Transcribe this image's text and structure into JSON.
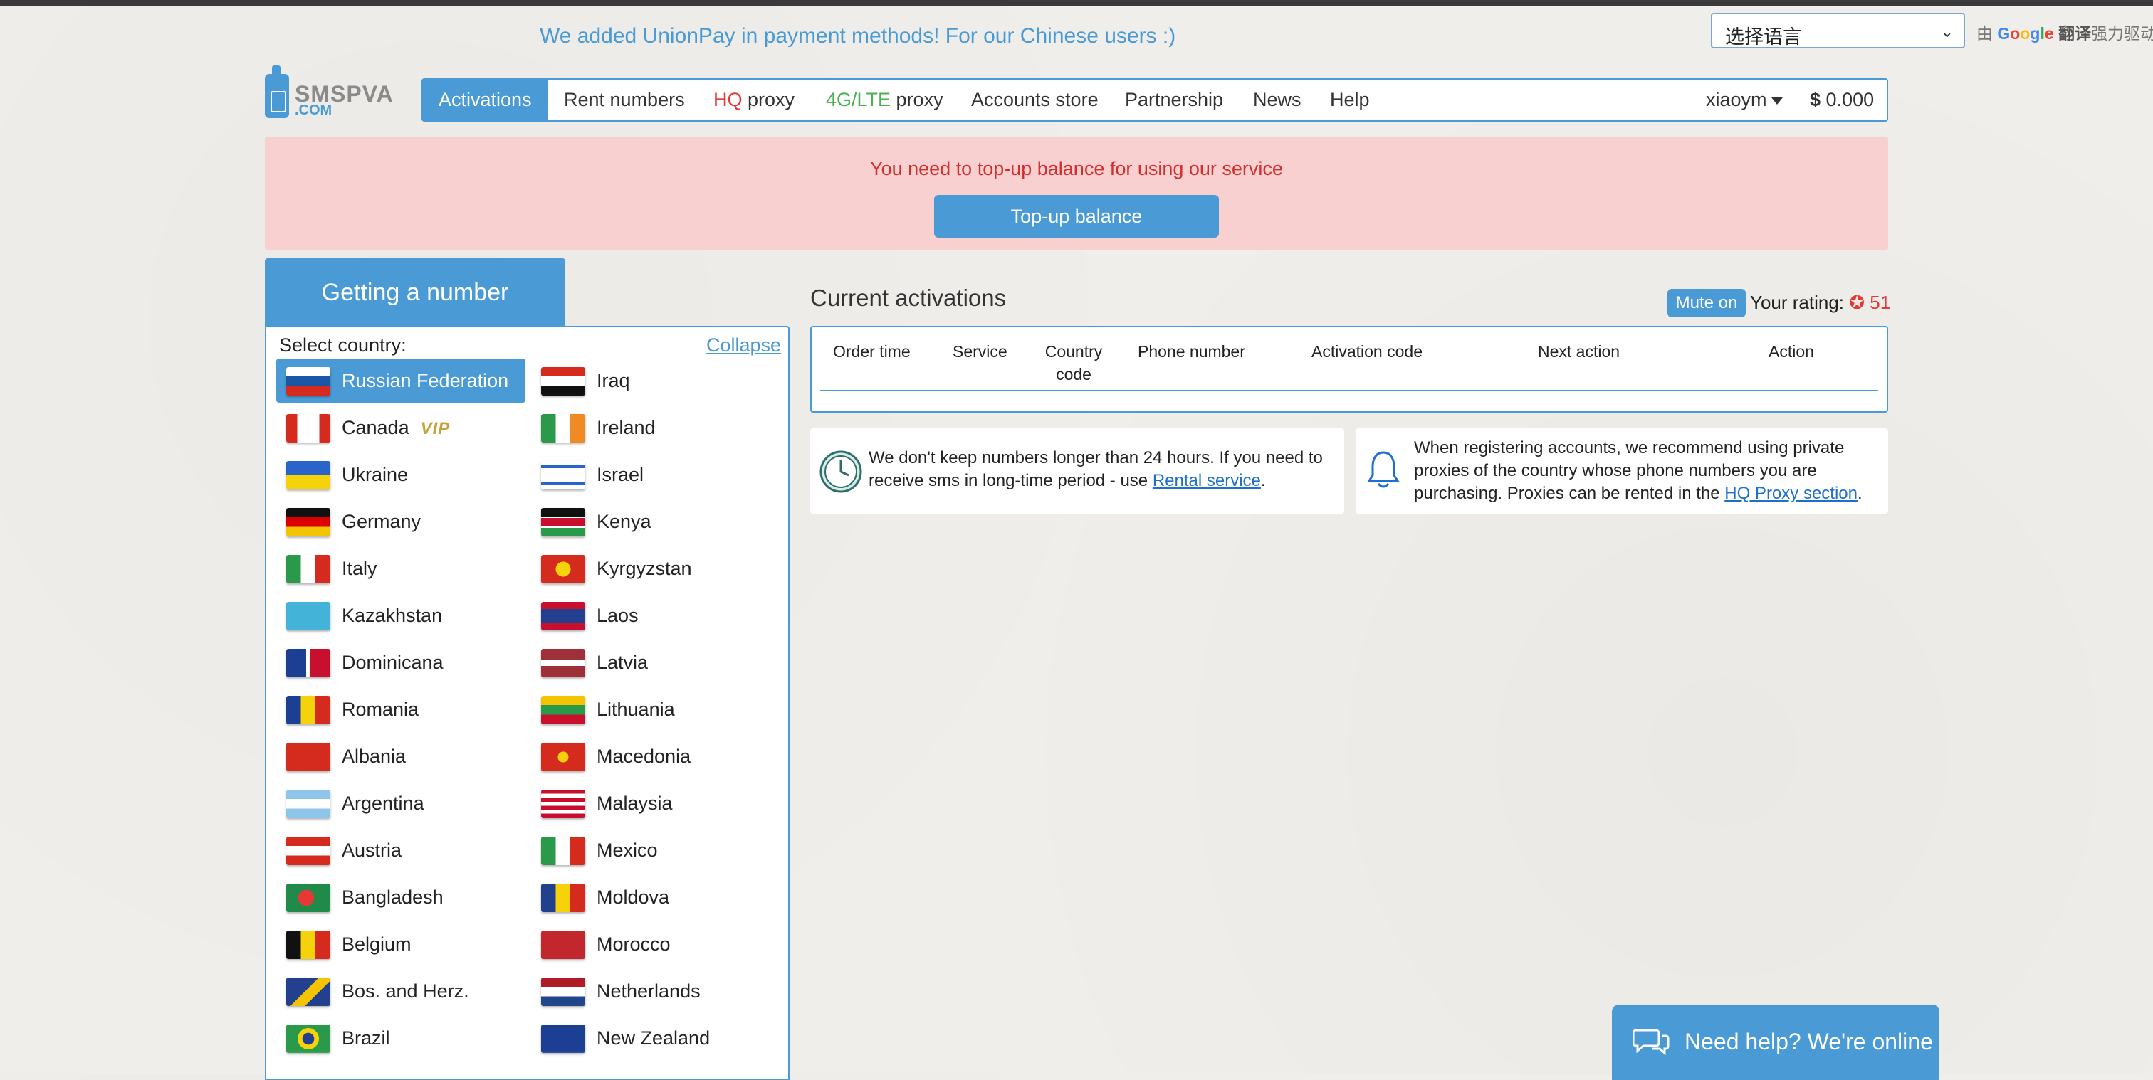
{
  "announcement": "We added UnionPay in payment methods! For our Chinese users :)",
  "language": {
    "selected": "选择语言",
    "powered_prefix": "由",
    "google": [
      "G",
      "o",
      "o",
      "g",
      "l",
      "e"
    ],
    "powered_suffix1": "翻译",
    "powered_suffix2": "强力驱动"
  },
  "logo": {
    "line1": "SMSPVA",
    "line2": ".COM"
  },
  "nav": {
    "activations": "Activations",
    "rent": "Rent numbers",
    "hq_prefix": "HQ",
    "hq_suffix": " proxy",
    "lte_prefix": "4G/LTE",
    "lte_suffix": " proxy",
    "accounts": "Accounts store",
    "partnership": "Partnership",
    "news": "News",
    "help": "Help",
    "user": "xiaoym",
    "balance_symbol": "$",
    "balance": "0.000"
  },
  "alert": {
    "message": "You need to top-up balance for using our service",
    "button": "Top-up balance"
  },
  "getting_number": {
    "tab_title": "Getting a number",
    "select_label": "Select country:",
    "collapse": "Collapse",
    "vip_label": "VIP",
    "left_column": [
      "Russian Federation",
      "Canada",
      "Ukraine",
      "Germany",
      "Italy",
      "Kazakhstan",
      "Dominicana",
      "Romania",
      "Albania",
      "Argentina",
      "Austria",
      "Bangladesh",
      "Belgium",
      "Bos. and Herz.",
      "Brazil"
    ],
    "right_column": [
      "Iraq",
      "Ireland",
      "Israel",
      "Kenya",
      "Kyrgyzstan",
      "Laos",
      "Latvia",
      "Lithuania",
      "Macedonia",
      "Malaysia",
      "Mexico",
      "Moldova",
      "Morocco",
      "Netherlands",
      "New Zealand"
    ],
    "selected_country": "Russian Federation"
  },
  "activations": {
    "title": "Current activations",
    "mute": "Mute on",
    "rating_label": "Your rating:",
    "rating_icon": "✪",
    "rating_value": "51",
    "columns": {
      "order_time": "Order time",
      "service": "Service",
      "country_code_1": "Country",
      "country_code_2": "code",
      "phone": "Phone number",
      "activation_code": "Activation code",
      "next_action": "Next action",
      "action": "Action"
    }
  },
  "info": {
    "retention_text": "We don't keep numbers longer than 24 hours. If you need to receive sms in long-time period - use ",
    "retention_link": "Rental service",
    "retention_end": ".",
    "proxy_text": "When registering accounts, we recommend using private proxies of the country whose phone numbers you are purchasing. Proxies can be rented in the ",
    "proxy_link": "HQ Proxy section",
    "proxy_end": "."
  },
  "chat": {
    "label": "Need help? We're online"
  },
  "colors": {
    "accent": "#4a9ad6",
    "alert_bg": "#f8d0d0",
    "alert_text": "#d32f2f",
    "background": "#efeeea"
  }
}
